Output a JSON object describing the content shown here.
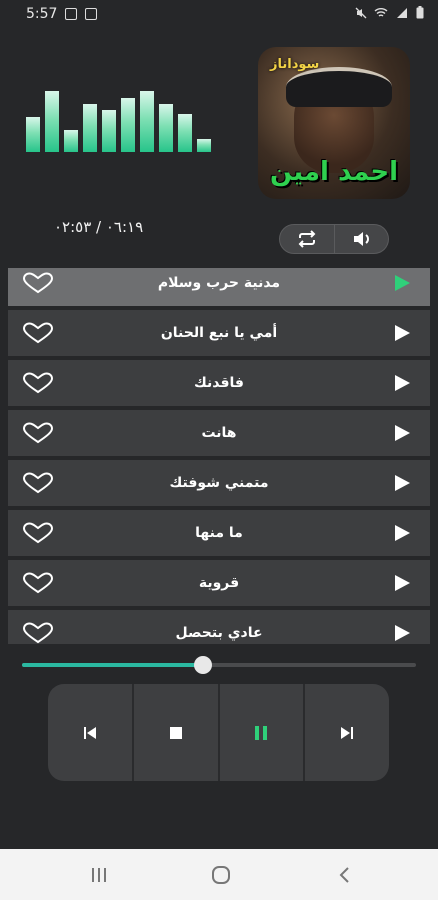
{
  "status_bar": {
    "time": "5:57",
    "icons": [
      "gallery-icon",
      "gallery-icon",
      "mute-icon",
      "wifi-icon",
      "signal-icon",
      "battery-icon"
    ]
  },
  "visualizer": {
    "levels": [
      0.55,
      0.95,
      0.35,
      0.75,
      0.65,
      0.85,
      0.95,
      0.75,
      0.6,
      0.2
    ]
  },
  "album": {
    "tag": "سوداناز",
    "title": "احمد امين"
  },
  "player": {
    "time_readout": "٠٦:١٩ / ٠٢:٥٣",
    "progress": 0.46,
    "controls": [
      "previous-icon",
      "stop-icon",
      "pause-icon",
      "next-icon"
    ]
  },
  "playlist": {
    "tracks": [
      {
        "title": "مدنية حرب وسلام",
        "active": true
      },
      {
        "title": "أمي يا نبع الحنان",
        "active": false
      },
      {
        "title": "فاقدنك",
        "active": false
      },
      {
        "title": "هانت",
        "active": false
      },
      {
        "title": "متمني شوفتك",
        "active": false
      },
      {
        "title": "ما منها",
        "active": false
      },
      {
        "title": "قروية",
        "active": false
      },
      {
        "title": "عادي بتحصل",
        "active": false
      }
    ]
  },
  "colors": {
    "accent": "#2fd07a",
    "seek": "#2bb9a1",
    "background": "#262729"
  }
}
